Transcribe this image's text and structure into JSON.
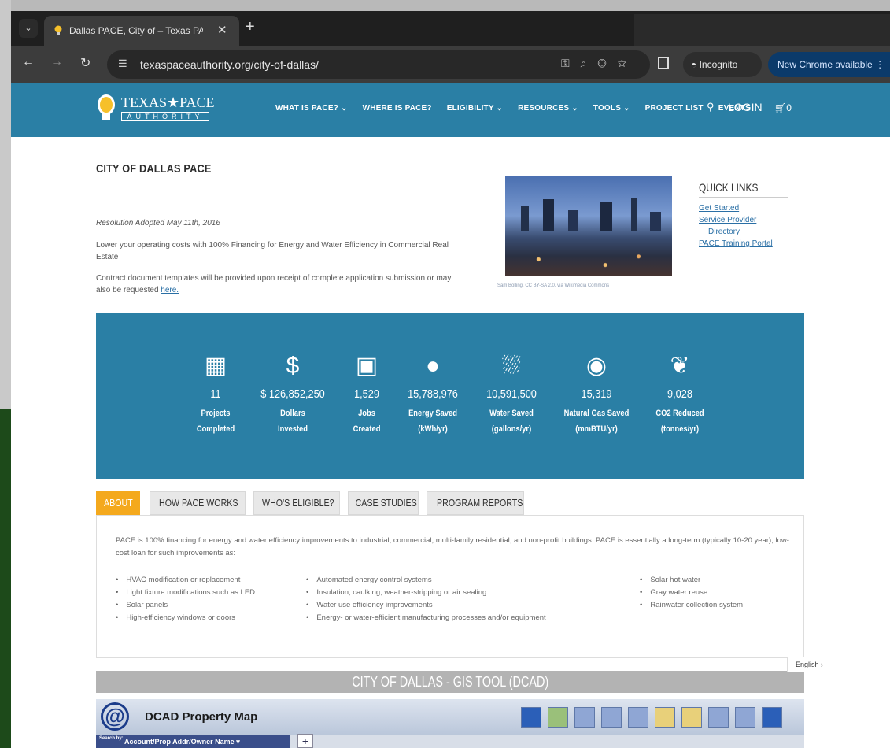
{
  "browser": {
    "tab_title": "Dallas PACE, City of – Texas PA…",
    "url": "texaspaceauthority.org/city-of-dallas/",
    "incognito_label": "Incognito",
    "update_label": "New Chrome available"
  },
  "site": {
    "logo_main": "TEXAS★PACE",
    "logo_sub": "AUTHORITY",
    "nav": [
      "WHAT IS PACE? ⌄",
      "WHERE IS PACE?",
      "ELIGIBILITY ⌄",
      "RESOURCES ⌄",
      "TOOLS ⌄",
      "PROJECT LIST",
      "EVENTS"
    ],
    "login": "LOGIN",
    "cart_count": "0"
  },
  "intro": {
    "title": "CITY OF DALLAS PACE",
    "resolution": "Resolution Adopted May 11th, 2016",
    "lead": "Lower your operating costs with 100% Financing for Energy and Water Efficiency in Commercial Real Estate",
    "contract_text": "Contract document templates will be provided upon receipt of complete application submission or may also be requested ",
    "contract_link": "here."
  },
  "photo_credit": "Sam Bolling, CC BY-SA 2.0, via Wikimedia Commons",
  "quick_links": {
    "title": "QUICK LINKS",
    "items": [
      "Get Started",
      "Service Provider",
      "Directory",
      "PACE Training Portal"
    ]
  },
  "stats": [
    {
      "icon": "building-icon",
      "glyph": "▦",
      "value": "11",
      "label1": "Projects",
      "label2": "Completed"
    },
    {
      "icon": "dollar-icon",
      "glyph": "$",
      "value": "$ 126,852,250",
      "label1": "Dollars",
      "label2": "Invested"
    },
    {
      "icon": "briefcase-icon",
      "glyph": "▣",
      "value": "1,529",
      "label1": "Jobs",
      "label2": "Created"
    },
    {
      "icon": "lightbulb-icon",
      "glyph": "●",
      "value": "15,788,976",
      "label1": "Energy Saved",
      "label2": "(kWh/yr)"
    },
    {
      "icon": "shower-icon",
      "glyph": "⛆",
      "value": "10,591,500",
      "label1": "Water Saved",
      "label2": "(gallons/yr)"
    },
    {
      "icon": "flame-icon",
      "glyph": "◉",
      "value": "15,319",
      "label1": "Natural Gas Saved",
      "label2": "(mmBTU/yr)"
    },
    {
      "icon": "leaf-icon",
      "glyph": "❦",
      "value": "9,028",
      "label1": "CO2 Reduced",
      "label2": "(tonnes/yr)"
    }
  ],
  "tabs": [
    "ABOUT",
    "HOW PACE WORKS",
    "WHO'S ELIGIBLE?",
    "CASE STUDIES",
    "PROGRAM REPORTS"
  ],
  "about": {
    "text": "PACE is 100% financing for energy and water efficiency improvements to industrial, commercial, multi-family residential, and non-profit buildings. PACE is essentially a long-term (typically 10-20 year), low-cost loan for such improvements as:",
    "col1": [
      "HVAC modification or replacement",
      "Light fixture modifications such as LED",
      "Solar panels",
      "High-efficiency windows or doors"
    ],
    "col2": [
      "Automated energy control systems",
      "Insulation, caulking, weather-stripping or air sealing",
      "Water use efficiency improvements",
      "Energy- or water-efficient manufacturing processes and/or equipment"
    ],
    "col3": [
      "Solar hot water",
      "Gray water reuse",
      "Rainwater collection system"
    ]
  },
  "gis": {
    "title": "CITY OF DALLAS - GIS TOOL (DCAD)",
    "map_title": "DCAD Property Map",
    "search_by": "Search by:",
    "search_field": "Account/Prop Addr/Owner Name"
  },
  "language": "English"
}
